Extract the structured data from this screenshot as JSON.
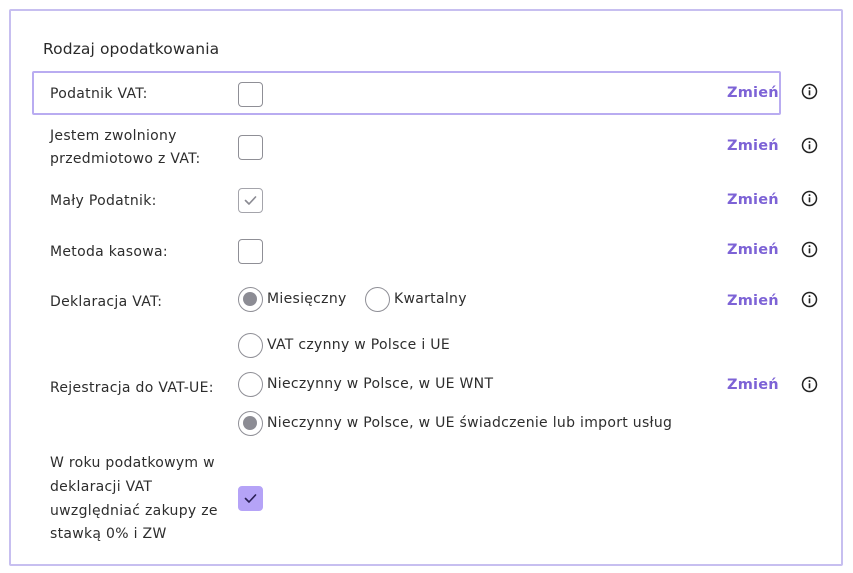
{
  "section": {
    "title": "Rodzaj opodatkowania"
  },
  "rows": {
    "vat_payer": {
      "label": "Podatnik VAT:",
      "checked": false,
      "change": "Zmień"
    },
    "vat_exempt": {
      "label_line1": "Jestem zwolniony",
      "label_line2": "przedmiotowo z VAT:",
      "checked": false,
      "change": "Zmień"
    },
    "small_taxpayer": {
      "label": "Mały Podatnik:",
      "checked": true,
      "change": "Zmień"
    },
    "cash_method": {
      "label": "Metoda kasowa:",
      "checked": false,
      "change": "Zmień"
    },
    "vat_declaration": {
      "label": "Deklaracja VAT:",
      "options": [
        "Miesięczny",
        "Kwartalny"
      ],
      "selected": "Miesięczny",
      "change": "Zmień"
    },
    "vat_ue": {
      "label": "Rejestracja do VAT-UE:",
      "options": [
        "VAT czynny w Polsce i UE",
        "Nieczynny w Polsce, w UE WNT",
        "Nieczynny w Polsce, w UE świadczenie lub import usług"
      ],
      "selected": "Nieczynny w Polsce, w UE świadczenie lub import usług",
      "change": "Zmień"
    },
    "zero_rate": {
      "label_line1": "W roku podatkowym w",
      "label_line2": "deklaracji VAT",
      "label_line3": "uwzględniać zakupy ze",
      "label_line4": "stawką 0% i ZW",
      "checked": true
    }
  },
  "colors": {
    "accent": "#7d63d6",
    "border": "#c7bff0",
    "checkbox_checked": "#b5a3f7"
  }
}
